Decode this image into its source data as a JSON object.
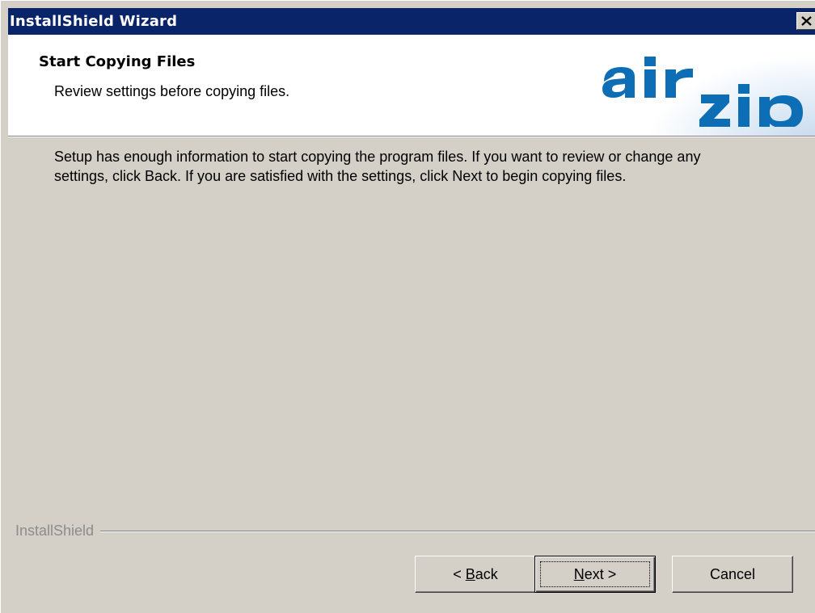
{
  "window": {
    "title": "InstallShield Wizard"
  },
  "header": {
    "title": "Start Copying Files",
    "subtitle": "Review settings before copying files.",
    "logo_text": "airzip",
    "logo_color": "#0d6eb5"
  },
  "body": {
    "text": "Setup has enough information to start copying the program files.  If you want to review or change any settings, click Back.  If you are satisfied with the settings, click Next to begin copying files."
  },
  "footer": {
    "brand_label": "InstallShield"
  },
  "buttons": {
    "back": {
      "prefix": "< ",
      "mnemonic": "B",
      "rest": "ack"
    },
    "next": {
      "mnemonic": "N",
      "rest": "ext >"
    },
    "cancel": {
      "label": "Cancel"
    }
  },
  "icons": {
    "close": "close-x-icon"
  }
}
